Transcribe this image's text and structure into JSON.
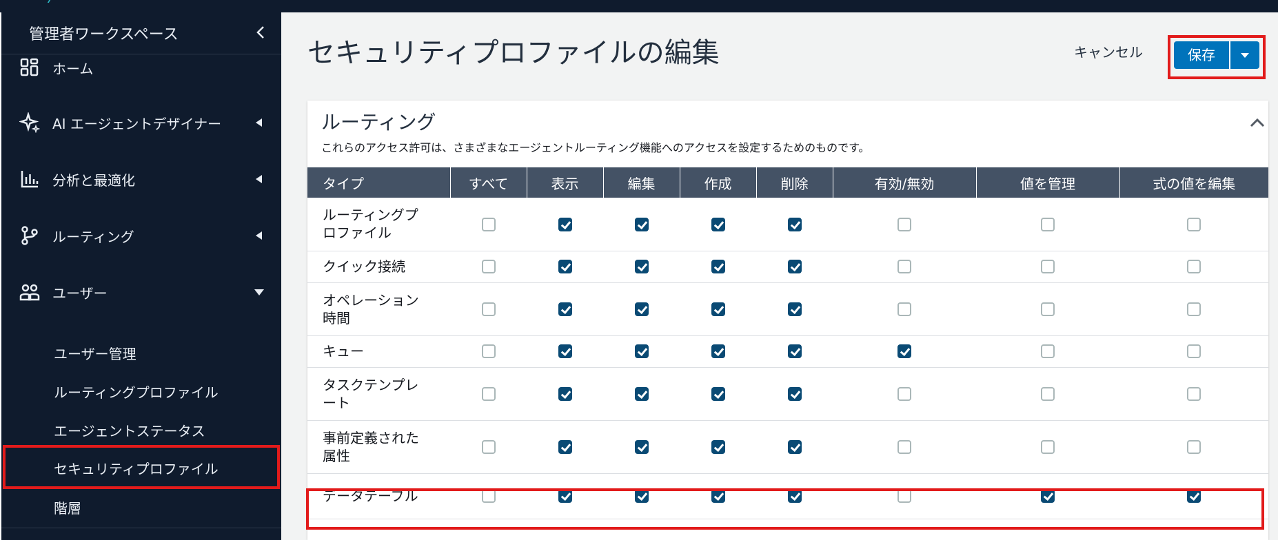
{
  "sidebar": {
    "workspace_title": "管理者ワークスペース",
    "collapse_icon": "chevron-left-icon",
    "nav": [
      {
        "label": "ホーム",
        "icon": "home-grid-icon",
        "caret": ""
      },
      {
        "label": "AI エージェントデザイナー",
        "icon": "sparkle-icon",
        "caret": "◀"
      },
      {
        "label": "分析と最適化",
        "icon": "bar-chart-icon",
        "caret": "◀"
      },
      {
        "label": "ルーティング",
        "icon": "routing-icon",
        "caret": "◀"
      },
      {
        "label": "ユーザー",
        "icon": "users-icon",
        "caret": "▼"
      }
    ],
    "sub_items": [
      {
        "label": "ユーザー管理"
      },
      {
        "label": "ルーティングプロファイル"
      },
      {
        "label": "エージェントステータス"
      },
      {
        "label": "セキュリティプロファイル",
        "active": true
      },
      {
        "label": "階層"
      }
    ]
  },
  "header": {
    "title": "セキュリティプロファイルの編集",
    "cancel_label": "キャンセル",
    "save_label": "保存",
    "save_menu_icon": "caret-down-icon"
  },
  "section": {
    "title": "ルーティング",
    "description": "これらのアクセス許可は、さまざまなエージェントルーティング機能へのアクセスを設定するためのものです。",
    "collapse_icon": "chevron-up-icon"
  },
  "table": {
    "columns": [
      "タイプ",
      "すべて",
      "表示",
      "編集",
      "作成",
      "削除",
      "有効/無効",
      "値を管理",
      "式の値を編集"
    ],
    "rows": [
      {
        "type": "ルーティングプ\nロファイル",
        "checks": [
          false,
          true,
          true,
          true,
          true,
          false,
          false,
          false
        ]
      },
      {
        "type": "クイック接続",
        "checks": [
          false,
          true,
          true,
          true,
          true,
          false,
          false,
          false
        ]
      },
      {
        "type": "オペレーション\n時間",
        "checks": [
          false,
          true,
          true,
          true,
          true,
          false,
          false,
          false
        ]
      },
      {
        "type": "キュー",
        "checks": [
          false,
          true,
          true,
          true,
          true,
          true,
          false,
          false
        ]
      },
      {
        "type": "タスクテンプレ\nート",
        "checks": [
          false,
          true,
          true,
          true,
          true,
          false,
          false,
          false
        ]
      },
      {
        "type": "事前定義された\n属性",
        "checks": [
          false,
          true,
          true,
          true,
          true,
          false,
          false,
          false
        ]
      },
      {
        "type": "データテーブル",
        "checks": [
          false,
          true,
          true,
          true,
          true,
          false,
          true,
          true
        ],
        "highlighted": true
      }
    ]
  },
  "colors": {
    "sidebar_bg": "#0f1b2d",
    "primary": "#0073bb",
    "table_header": "#445265",
    "checkbox_checked": "#0a4a74",
    "highlight": "#e21b1b"
  }
}
